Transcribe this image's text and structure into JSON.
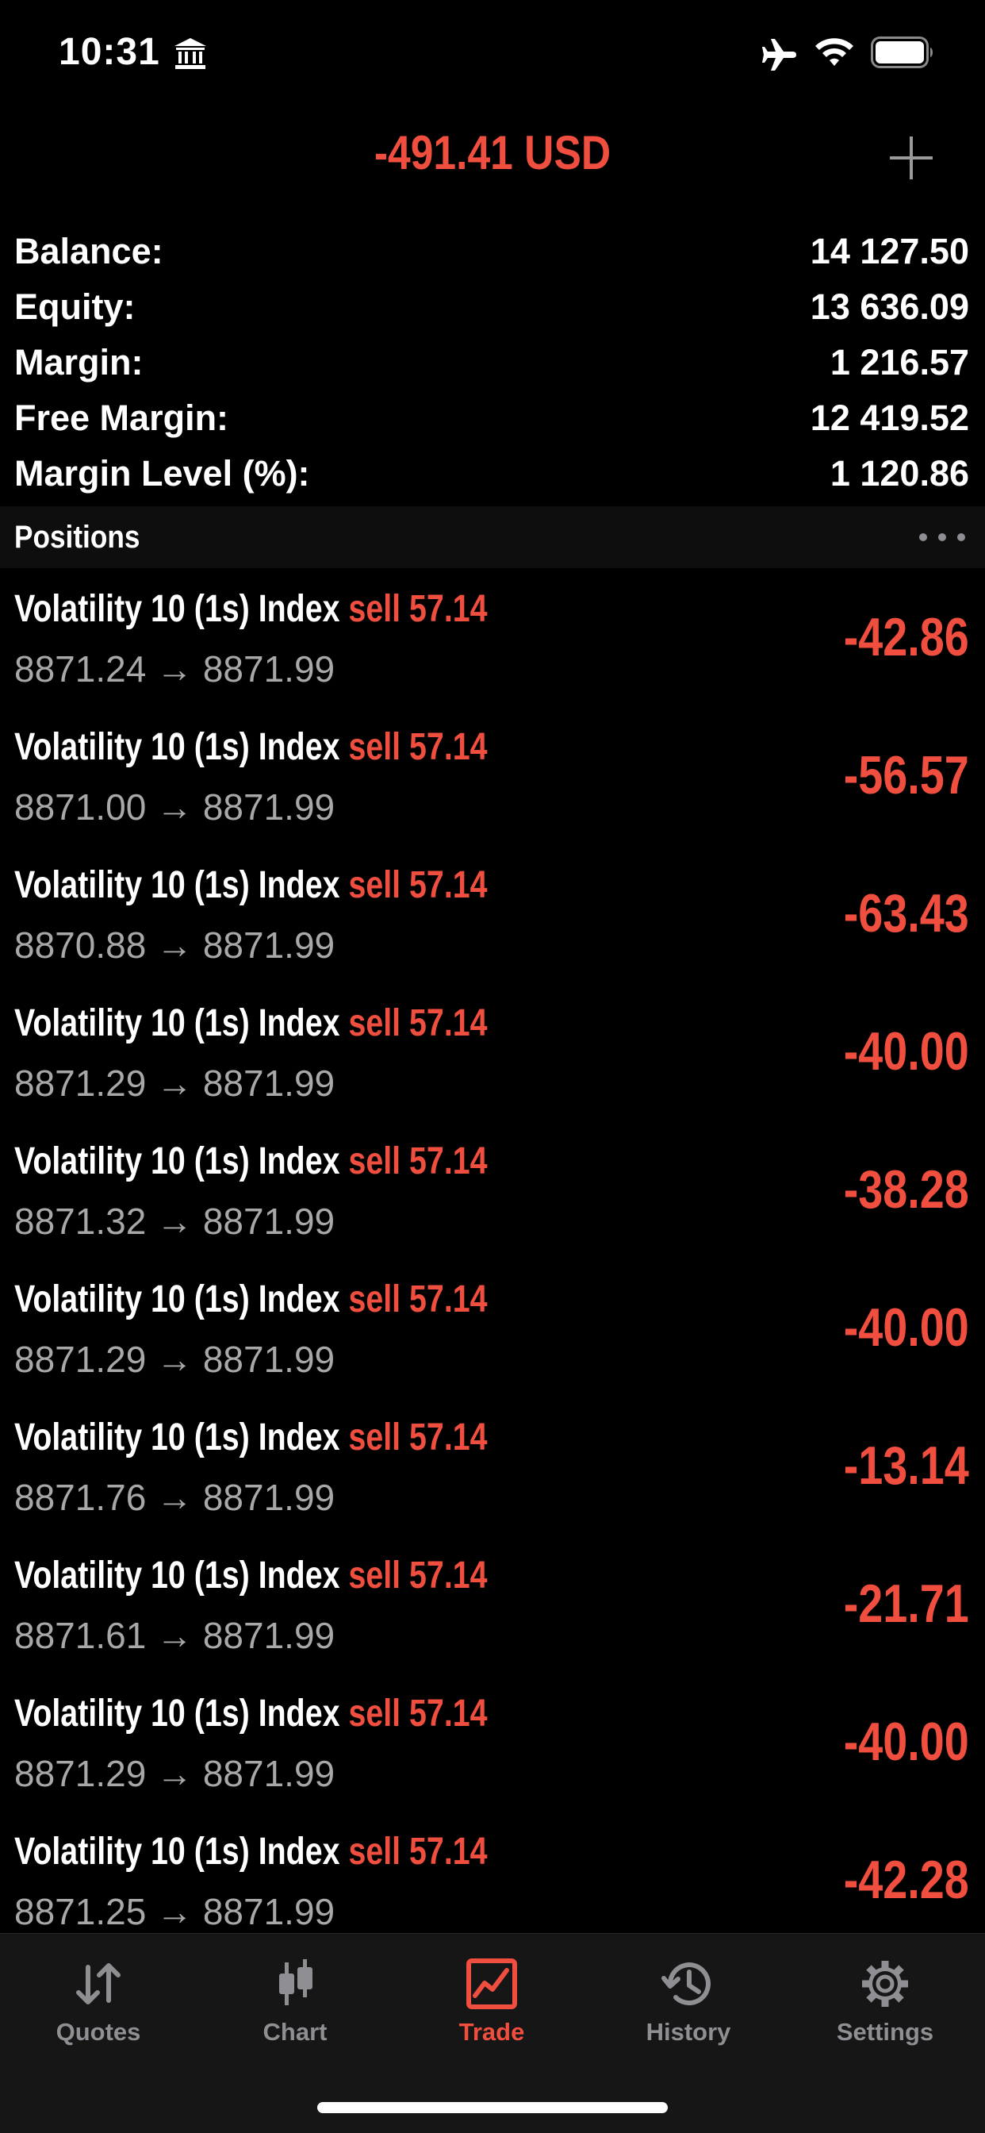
{
  "status_bar": {
    "time": "10:31"
  },
  "header": {
    "title": "-491.41 USD"
  },
  "summary": [
    {
      "label": "Balance:",
      "value": "14 127.50"
    },
    {
      "label": "Equity:",
      "value": "13 636.09"
    },
    {
      "label": "Margin:",
      "value": "1 216.57"
    },
    {
      "label": "Free Margin:",
      "value": "12 419.52"
    },
    {
      "label": "Margin Level (%):",
      "value": "1 120.86"
    }
  ],
  "positions_header": {
    "title": "Positions"
  },
  "positions": [
    {
      "symbol": "Volatility 10 (1s) Index",
      "side": "sell",
      "volume": "57.14",
      "open": "8871.24",
      "arrow": "→",
      "current": "8871.99",
      "profit": "-42.86"
    },
    {
      "symbol": "Volatility 10 (1s) Index",
      "side": "sell",
      "volume": "57.14",
      "open": "8871.00",
      "arrow": "→",
      "current": "8871.99",
      "profit": "-56.57"
    },
    {
      "symbol": "Volatility 10 (1s) Index",
      "side": "sell",
      "volume": "57.14",
      "open": "8870.88",
      "arrow": "→",
      "current": "8871.99",
      "profit": "-63.43"
    },
    {
      "symbol": "Volatility 10 (1s) Index",
      "side": "sell",
      "volume": "57.14",
      "open": "8871.29",
      "arrow": "→",
      "current": "8871.99",
      "profit": "-40.00"
    },
    {
      "symbol": "Volatility 10 (1s) Index",
      "side": "sell",
      "volume": "57.14",
      "open": "8871.32",
      "arrow": "→",
      "current": "8871.99",
      "profit": "-38.28"
    },
    {
      "symbol": "Volatility 10 (1s) Index",
      "side": "sell",
      "volume": "57.14",
      "open": "8871.29",
      "arrow": "→",
      "current": "8871.99",
      "profit": "-40.00"
    },
    {
      "symbol": "Volatility 10 (1s) Index",
      "side": "sell",
      "volume": "57.14",
      "open": "8871.76",
      "arrow": "→",
      "current": "8871.99",
      "profit": "-13.14"
    },
    {
      "symbol": "Volatility 10 (1s) Index",
      "side": "sell",
      "volume": "57.14",
      "open": "8871.61",
      "arrow": "→",
      "current": "8871.99",
      "profit": "-21.71"
    },
    {
      "symbol": "Volatility 10 (1s) Index",
      "side": "sell",
      "volume": "57.14",
      "open": "8871.29",
      "arrow": "→",
      "current": "8871.99",
      "profit": "-40.00"
    },
    {
      "symbol": "Volatility 10 (1s) Index",
      "side": "sell",
      "volume": "57.14",
      "open": "8871.25",
      "arrow": "→",
      "current": "8871.99",
      "profit": "-42.28"
    }
  ],
  "tabs": [
    {
      "label": "Quotes",
      "icon": "quotes-arrows-icon",
      "active": false
    },
    {
      "label": "Chart",
      "icon": "candlestick-icon",
      "active": false
    },
    {
      "label": "Trade",
      "icon": "trade-chart-icon",
      "active": true
    },
    {
      "label": "History",
      "icon": "history-clock-icon",
      "active": false
    },
    {
      "label": "Settings",
      "icon": "gear-icon",
      "active": false
    }
  ],
  "colors": {
    "accent": "#f04e3e",
    "inactive": "#8e8e93",
    "background": "#000000",
    "tab_bar": "#161616"
  }
}
